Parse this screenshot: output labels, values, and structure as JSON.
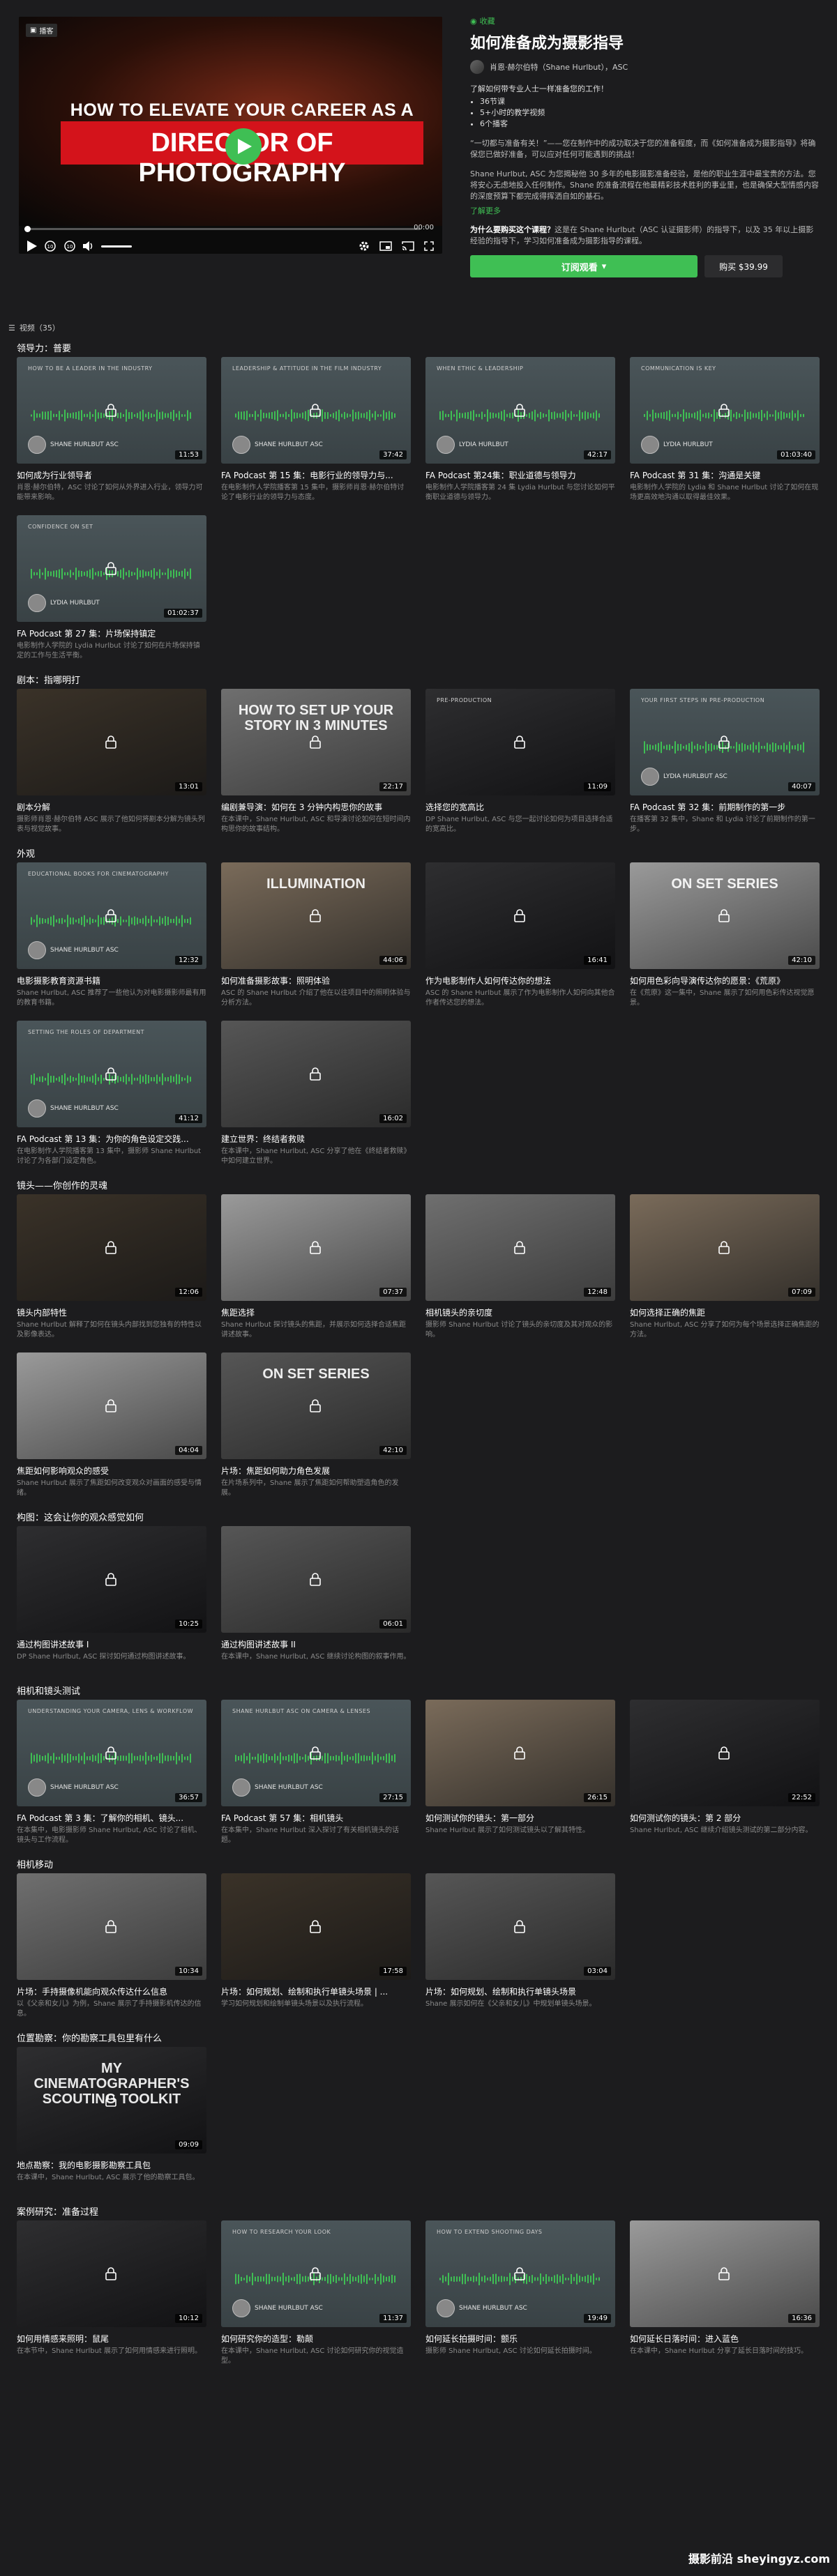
{
  "player": {
    "badge": "播客",
    "title_top": "HOW TO ELEVATE YOUR CAREER AS A",
    "title_main": "DIRECTOR OF PHOTOGRAPHY",
    "time": "00:00",
    "progress": 0,
    "volume": 1
  },
  "course": {
    "breadcrumb": "收藏",
    "title": "如何准备成为摄影指导",
    "author": "肖恩·赫尔伯特（Shane Hurlbut），ASC",
    "intro": "了解如何带专业人士一样准备您的工作！",
    "bullets": [
      "36节课",
      "5+小时的教学视频",
      "6个播客"
    ],
    "quote": "“一切都与准备有关！”——您在制作中的成功取决于您的准备程度，而《如何准备成为摄影指导》将确保您已做好准备，可以应对任何可能遇到的挑战！",
    "description": "Shane Hurlbut, ASC 为您揭秘他 30 多年的电影摄影准备经验，是他的职业生涯中最宝贵的方法。您将安心无虑地投入任何制作。Shane 的准备流程在他最精彩技术胜利的事业里，也是确保大型情感内容的深度预算下都完成得挥洒自如的基石。",
    "learn_more": "了解更多",
    "why_lead": "为什么要购买这个课程？",
    "why_text": "这是在 Shane Hurlbut（ASC 认证摄影师）的指导下，以及 35 年以上摄影经验的指导下，学习如何准备成为摄影指导的课程。",
    "subscribe": "订阅观看",
    "buy": "购买 $39.99"
  },
  "episodes_label": "视频（35）",
  "sections": [
    {
      "title": "领导力：普要",
      "cards": [
        {
          "type": "pod",
          "cap": "HOW TO BE A LEADER IN THE INDUSTRY",
          "host": "SHANE HURLBUT ASC",
          "dur": "11:53",
          "title": "如何成为行业领导者",
          "desc": "肖恩·赫尔伯特，ASC 讨论了如何从外界进入行业，领导力可能带来影响。"
        },
        {
          "type": "pod",
          "cap": "LEADERSHIP & ATTITUDE IN THE FILM INDUSTRY",
          "host": "SHANE HURLBUT ASC",
          "dur": "37:42",
          "title": "FA Podcast 第 15 集：电影行业的领导力与...",
          "desc": "在电影制作人学院播客第 15 集中，摄影师肖恩·赫尔伯特讨论了电影行业的领导力与态度。"
        },
        {
          "type": "pod",
          "cap": "WHEN ETHIC & LEADERSHIP",
          "host": "LYDIA HURLBUT",
          "dur": "42:17",
          "title": "FA Podcast 第24集：职业道德与领导力",
          "desc": "电影制作人学院播客第 24 集 Lydia Hurlbut 与您讨论如何平衡职业道德与领导力。"
        },
        {
          "type": "pod",
          "cap": "COMMUNICATION IS KEY",
          "host": "LYDIA HURLBUT",
          "dur": "01:03:40",
          "title": "FA Podcast 第 31 集：沟通是关键",
          "desc": "电影制作人学院的 Lydia 和 Shane Hurlbut 讨论了如何在现场更高效地沟通以取得最佳效果。"
        }
      ]
    },
    {
      "title": "",
      "cards": [
        {
          "type": "pod",
          "cap": "CONFIDENCE ON SET",
          "host": "LYDIA HURLBUT",
          "dur": "01:02:37",
          "title": "FA Podcast 第 27 集：片场保持镇定",
          "desc": "电影制作人学院的 Lydia Hurlbut 讨论了如何在片场保持镇定的工作与生活平衡。"
        }
      ]
    },
    {
      "title": "剧本：指哪明打",
      "cards": [
        {
          "type": "a",
          "dur": "13:01",
          "title": "剧本分解",
          "desc": "摄影师肖恩·赫尔伯特 ASC 展示了他如何将剧本分解为镜头列表与视觉故事。"
        },
        {
          "type": "b",
          "big": "HOW TO SET UP YOUR STORY IN 3 MINUTES",
          "dur": "22:17",
          "title": "编剧兼导演：如何在 3 分钟内构思你的故事",
          "desc": "在本课中，Shane Hurlbut, ASC 和导演讨论如何在短时间内构思你的故事结构。"
        },
        {
          "type": "c",
          "cap": "PRE-PRODUCTION",
          "dur": "11:09",
          "title": "选择您的宽高比",
          "desc": "DP Shane Hurlbut, ASC 与您一起讨论如何为项目选择合适的宽高比。"
        },
        {
          "type": "pod",
          "cap": "YOUR FIRST STEPS IN PRE-PRODUCTION",
          "host": "LYDIA HURLBUT ASC",
          "dur": "40:07",
          "title": "FA Podcast 第 32 集：前期制作的第一步",
          "desc": "在播客第 32 集中，Shane 和 Lydia 讨论了前期制作的第一步。"
        }
      ]
    },
    {
      "title": "外观",
      "cards": [
        {
          "type": "pod",
          "cap": "EDUCATIONAL BOOKS FOR CINEMATOGRAPHY",
          "host": "SHANE HURLBUT ASC",
          "dur": "12:32",
          "title": "电影摄影教育资源书籍",
          "desc": "Shane Hurlbut, ASC 推荐了一些他认为对电影摄影师最有用的教育书籍。"
        },
        {
          "type": "d",
          "big": "ILLUMINATION",
          "dur": "44:06",
          "title": "如何准备摄影故事：照明体验",
          "desc": "ASC 的 Shane Hurlbut 介绍了他在以往项目中的照明体验与分析方法。"
        },
        {
          "type": "c",
          "dur": "16:41",
          "title": "作为电影制作人如何传达你的想法",
          "desc": "ASC 的 Shane Hurlbut 展示了作为电影制作人如何向其他合作者传达您的想法。"
        },
        {
          "type": "e",
          "big": "ON SET SERIES",
          "dur": "42:10",
          "title": "如何用色彩向导演传达你的愿景：《荒原》",
          "desc": "在《荒原》这一集中，Shane 展示了如何用色彩传达视觉愿景。"
        }
      ]
    },
    {
      "title": "",
      "cards": [
        {
          "type": "pod",
          "cap": "SETTING THE ROLES OF DEPARTMENT",
          "host": "SHANE HURLBUT ASC",
          "dur": "41:12",
          "title": "FA Podcast 第 13 集：为你的角色设定交践...",
          "desc": "在电影制作人学院播客第 13 集中，摄影师 Shane Hurlbut 讨论了为各部门设定角色。"
        },
        {
          "type": "f",
          "dur": "16:02",
          "title": "建立世界：终结者救赎",
          "desc": "在本课中，Shane Hurlbut, ASC 分享了他在《终结者救赎》中如何建立世界。"
        }
      ]
    },
    {
      "title": "镜头——你创作的灵魂",
      "cards": [
        {
          "type": "a",
          "dur": "12:06",
          "title": "镜头内部特性",
          "desc": "Shane Hurlbut 解释了如何在镜头内部找到您独有的特性以及影像表达。"
        },
        {
          "type": "e",
          "dur": "07:37",
          "title": "焦距选择",
          "desc": "Shane Hurlbut 探讨镜头的焦距，并展示如何选择合适焦距讲述故事。"
        },
        {
          "type": "b",
          "dur": "12:48",
          "title": "相机镜头的亲切度",
          "desc": "摄影师 Shane Hurlbut 讨论了镜头的亲切度及其对观众的影响。"
        },
        {
          "type": "d",
          "dur": "07:09",
          "title": "如何选择正确的焦距",
          "desc": "Shane Hurlbut, ASC 分享了如何为每个场景选择正确焦距的方法。"
        }
      ]
    },
    {
      "title": "",
      "cards": [
        {
          "type": "e",
          "dur": "04:04",
          "title": "焦距如何影响观众的感受",
          "desc": "Shane Hurlbut 展示了焦距如何改变观众对画面的感受与情绪。"
        },
        {
          "type": "f",
          "big": "ON SET SERIES",
          "dur": "42:10",
          "title": "片场：焦距如何助力角色发展",
          "desc": "在片场系列中，Shane 展示了焦距如何帮助塑造角色的发展。"
        }
      ]
    },
    {
      "title": "构图：这会让你的观众感觉如何",
      "cards": [
        {
          "type": "c",
          "dur": "10:25",
          "title": "通过构图讲述故事 I",
          "desc": "DP Shane Hurlbut, ASC 探讨如何通过构图讲述故事。"
        },
        {
          "type": "f",
          "dur": "06:01",
          "title": "通过构图讲述故事 II",
          "desc": "在本课中，Shane Hurlbut, ASC 继续讨论构图的叙事作用。"
        }
      ]
    },
    {
      "title": "相机和镜头测试",
      "cards": [
        {
          "type": "pod",
          "cap": "UNDERSTANDING YOUR CAMERA, LENS & WORKFLOW",
          "host": "SHANE HURLBUT ASC",
          "dur": "36:57",
          "title": "FA Podcast 第 3 集：了解你的相机、镜头...",
          "desc": "在本集中，电影摄影师 Shane Hurlbut, ASC 讨论了相机、镜头与工作流程。"
        },
        {
          "type": "pod",
          "cap": "SHANE HURLBUT ASC ON CAMERA & LENSES",
          "host": "SHANE HURLBUT ASC",
          "dur": "27:15",
          "title": "FA Podcast 第 57 集：相机镜头",
          "desc": "在本集中，Shane Hurlbut 深入探讨了有关相机镜头的话题。"
        },
        {
          "type": "d",
          "dur": "26:15",
          "title": "如何测试你的镜头：第一部分",
          "desc": "Shane Hurlbut 展示了如何测试镜头以了解其特性。"
        },
        {
          "type": "c",
          "dur": "22:52",
          "title": "如何测试你的镜头：第 2 部分",
          "desc": "Shane Hurlbut, ASC 继续介绍镜头测试的第二部分内容。"
        }
      ]
    },
    {
      "title": "相机移动",
      "cards": [
        {
          "type": "b",
          "dur": "10:34",
          "title": "片场：手持摄像机能向观众传达什么信息",
          "desc": "以《父亲和女儿》为例，Shane 展示了手持摄影机传达的信息。"
        },
        {
          "type": "a",
          "dur": "17:58",
          "title": "片场：如何规划、绘制和执行单镜头场景 | ...",
          "desc": "学习如何规划和绘制单镜头场景以及执行流程。"
        },
        {
          "type": "f",
          "dur": "03:04",
          "title": "片场：如何规划、绘制和执行单镜头场景",
          "desc": "Shane 展示如何在《父亲和女儿》中规划单镜头场景。"
        }
      ]
    },
    {
      "title": "位置勘察：你的勘察工具包里有什么",
      "cards": [
        {
          "type": "c",
          "big": "MY CINEMATOGRAPHER'S SCOUTING TOOLKIT",
          "dur": "09:09",
          "title": "地点勘察：我的电影摄影勘察工具包",
          "desc": "在本课中，Shane Hurlbut, ASC 展示了他的勘察工具包。"
        }
      ]
    },
    {
      "title": "案例研究：准备过程",
      "cards": [
        {
          "type": "c",
          "dur": "10:12",
          "title": "如何用情感来照明：鼠尾",
          "desc": "在本节中，Shane Hurlbut 展示了如何用情感来进行照明。"
        },
        {
          "type": "pod",
          "cap": "HOW TO RESEARCH YOUR LOOK",
          "host": "SHANE HURLBUT ASC",
          "dur": "11:37",
          "title": "如何研究你的造型：勒颠",
          "desc": "在本课中，Shane Hurlbut, ASC 讨论如何研究你的视觉造型。"
        },
        {
          "type": "pod",
          "cap": "HOW TO EXTEND SHOOTING DAYS",
          "host": "SHANE HURLBUT ASC",
          "dur": "19:49",
          "title": "如何延长拍摄时间：颤乐",
          "desc": "摄影师 Shane Hurlbut, ASC 讨论如何延长拍摄时间。"
        },
        {
          "type": "e",
          "dur": "16:36",
          "title": "如何延长日落时间：进入蓝色",
          "desc": "在本课中，Shane Hurlbut 分享了延长日落时间的技巧。"
        }
      ]
    }
  ],
  "watermark": "摄影前沿 sheyingyz.com"
}
